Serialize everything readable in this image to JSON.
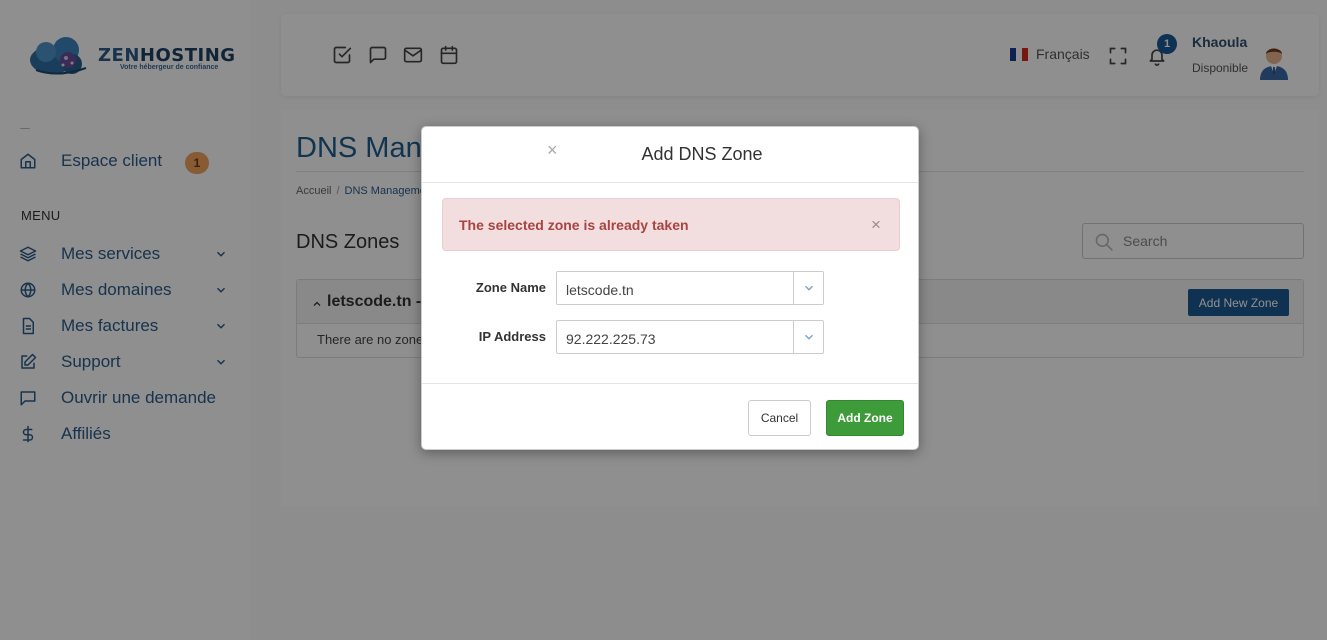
{
  "brand": {
    "name_part1": "ZEN",
    "name_part2": "HOSTING",
    "tagline": "Votre hébergeur de confiance",
    "primary_color": "#1f5d8f"
  },
  "sidebar": {
    "top_item": {
      "label": "Espace client",
      "icon": "home-icon",
      "badge": "1"
    },
    "menu_title": "MENU",
    "items": [
      {
        "label": "Mes services",
        "icon": "layers-icon",
        "has_submenu": true
      },
      {
        "label": "Mes domaines",
        "icon": "globe-icon",
        "has_submenu": true
      },
      {
        "label": "Mes factures",
        "icon": "file-icon",
        "has_submenu": true
      },
      {
        "label": "Support",
        "icon": "edit-icon",
        "has_submenu": true
      },
      {
        "label": "Ouvrir une demande",
        "icon": "chat-icon",
        "has_submenu": false
      },
      {
        "label": "Affiliés",
        "icon": "dollar-icon",
        "has_submenu": false
      }
    ]
  },
  "topbar": {
    "quick_icons": [
      "check-square-icon",
      "message-square-icon",
      "mail-icon",
      "calendar-icon"
    ],
    "language": "Français",
    "notification_count": "1",
    "user": {
      "name": "Khaoula",
      "status": "Disponible"
    }
  },
  "page": {
    "title": "DNS Management",
    "breadcrumb": [
      "Accueil",
      "DNS Management"
    ],
    "section_title": "DNS Zones",
    "search_placeholder": "Search",
    "zone_panel": {
      "title": "letscode.tn -",
      "add_button": "Add New Zone",
      "empty_text": "There are no zones"
    }
  },
  "modal": {
    "title": "Add DNS Zone",
    "close_symbol": "×",
    "alert": {
      "text": "The selected zone is already taken",
      "close_symbol": "×"
    },
    "fields": [
      {
        "label": "Zone Name",
        "value": "letscode.tn"
      },
      {
        "label": "IP Address",
        "value": "92.222.225.73"
      }
    ],
    "cancel_label": "Cancel",
    "submit_label": "Add Zone"
  },
  "colors": {
    "accent": "#1e5a92",
    "success": "#3e9b3a",
    "danger_text": "#a94442",
    "danger_bg": "#f2dede",
    "badge_orange": "#f0a35c"
  }
}
